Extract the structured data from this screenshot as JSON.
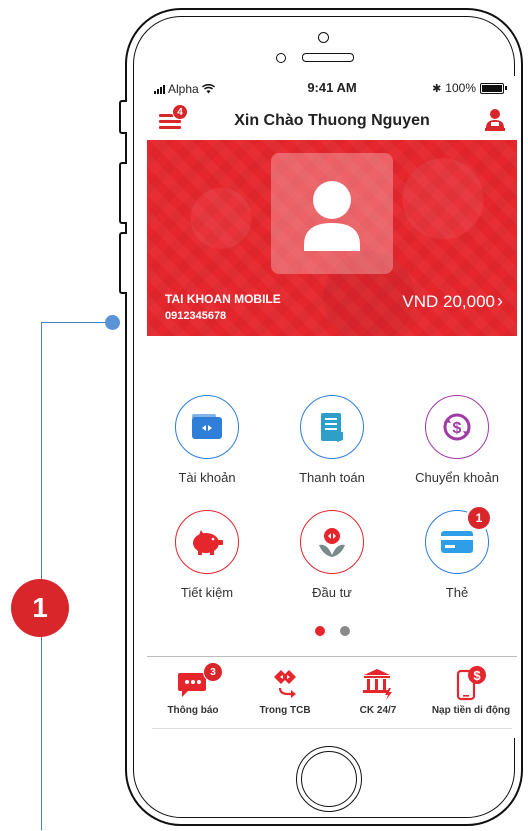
{
  "callout": {
    "number": "1"
  },
  "status_bar": {
    "carrier": "Alpha",
    "time": "9:41 AM",
    "battery": "100%"
  },
  "header": {
    "greeting": "Xin Chào Thuong Nguyen",
    "menu_badge": "4"
  },
  "account": {
    "name": "TAI KHOAN MOBILE",
    "number": "0912345678",
    "balance": "VND 20,000",
    "arrow": "›"
  },
  "grid": [
    {
      "label": "Tài khoản",
      "icon": "wallet-icon"
    },
    {
      "label": "Thanh toán",
      "icon": "bill-icon"
    },
    {
      "label": "Chuyển khoản",
      "icon": "transfer-icon"
    },
    {
      "label": "Tiết kiệm",
      "icon": "piggy-bank-icon"
    },
    {
      "label": "Đầu tư",
      "icon": "investment-icon"
    },
    {
      "label": "Thẻ",
      "icon": "card-icon",
      "badge": "1"
    }
  ],
  "pagination": {
    "active": 1,
    "total": 2
  },
  "bottom_nav": [
    {
      "label": "Thông báo",
      "icon": "notification-icon",
      "badge": "3"
    },
    {
      "label": "Trong TCB",
      "icon": "internal-transfer-icon"
    },
    {
      "label": "CK 24/7",
      "icon": "bank-transfer-icon"
    },
    {
      "label": "Nạp tiền di động",
      "icon": "mobile-topup-icon"
    }
  ],
  "colors": {
    "brand_red": "#e6262d",
    "blue": "#2f7ed8",
    "purple": "#a03aa8",
    "callout_blue": "#4a7fc0"
  }
}
